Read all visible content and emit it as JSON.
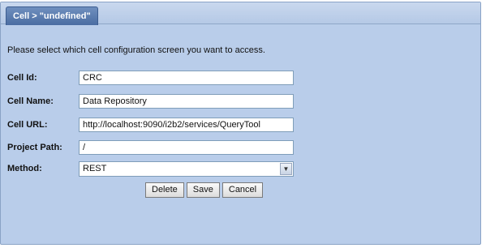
{
  "tab": {
    "label": "Cell > \"undefined\""
  },
  "prompt": "Please select which cell configuration screen you want to access.",
  "form": {
    "cell_id": {
      "label": "Cell Id:",
      "value": "CRC"
    },
    "cell_name": {
      "label": "Cell Name:",
      "value": "Data Repository"
    },
    "cell_url": {
      "label": "Cell URL:",
      "value": "http://localhost:9090/i2b2/services/QueryTool"
    },
    "project_path": {
      "label": "Project Path:",
      "value": "/"
    },
    "method": {
      "label": "Method:",
      "value": "REST"
    }
  },
  "buttons": {
    "delete": "Delete",
    "save": "Save",
    "cancel": "Cancel"
  }
}
